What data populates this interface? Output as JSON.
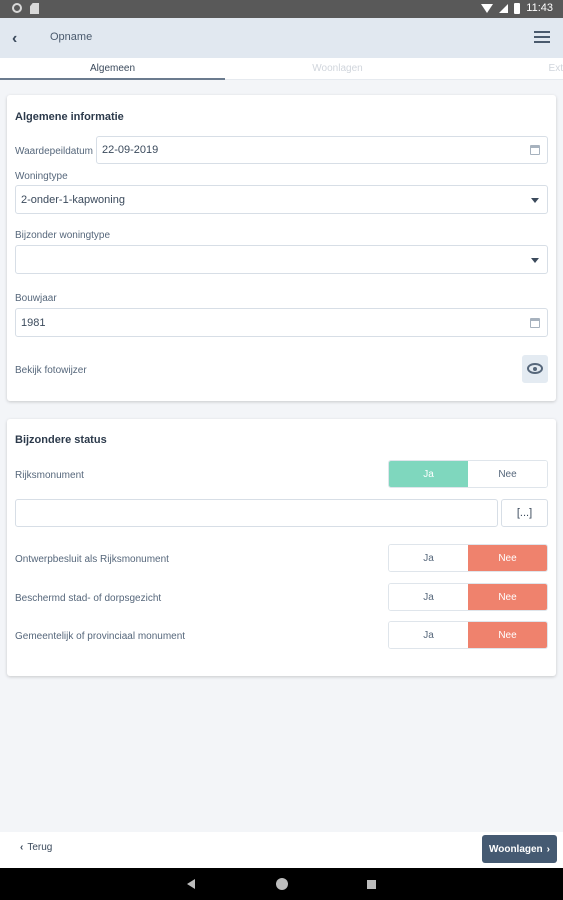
{
  "status_bar": {
    "time": "11:43"
  },
  "app_bar": {
    "back_icon": "chevron-left-icon",
    "title": "Opname",
    "menu_icon": "hamburger-menu-icon"
  },
  "tabs": [
    {
      "label": "Algemeen",
      "active": true
    },
    {
      "label": "Woonlagen",
      "active": false
    },
    {
      "label": "Ext",
      "active": false
    }
  ],
  "general_info": {
    "title": "Algemene informatie",
    "peildatum_label": "Waardepeildatum",
    "peildatum_value": "22-09-2019",
    "woningtype_label": "Woningtype",
    "woningtype_value": "2-onder-1-kapwoning",
    "bijzonder_label": "Bijzonder woningtype",
    "bijzonder_value": "",
    "bouwjaar_label": "Bouwjaar",
    "bouwjaar_value": "1981",
    "fotowijzer_label": "Bekijk fotowijzer"
  },
  "special_status": {
    "title": "Bijzondere status",
    "rijksmonument_label": "Rijksmonument",
    "rijksmonument_value": "Ja",
    "notes_value": "",
    "ellipsis_label": "[...]",
    "ontwerpbesluit_label": "Ontwerpbesluit als Rijksmonument",
    "ontwerpbesluit_value": "Nee",
    "beschermd_label": "Beschermd stad- of dorpsgezicht",
    "beschermd_value": "Nee",
    "gemeentelijk_label": "Gemeentelijk of provinciaal monument",
    "gemeentelijk_value": "Nee",
    "yes_label": "Ja",
    "no_label": "Nee"
  },
  "footer": {
    "back_label": "Terug",
    "next_label": "Woonlagen"
  },
  "colors": {
    "yes_active": "#7fd7be",
    "no_active": "#ef826d",
    "primary": "#455a72"
  }
}
